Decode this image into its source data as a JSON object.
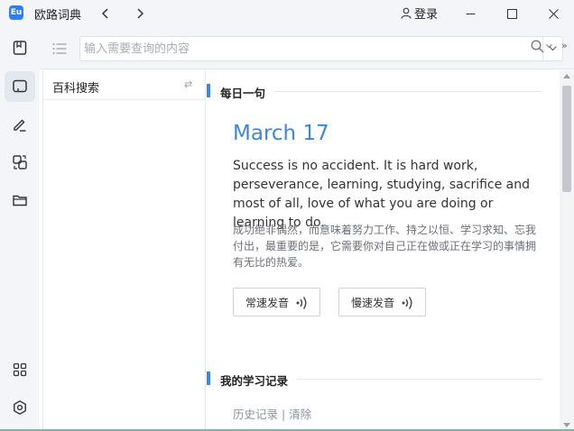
{
  "app": {
    "title": "欧路词典",
    "logo_text": "Eu"
  },
  "titlebar": {
    "login_label": "登录",
    "back_icon": "chevron-left-icon",
    "forward_icon": "chevron-right-icon"
  },
  "rail": {
    "items": [
      {
        "name": "dictionary",
        "icon": "book-icon",
        "active": false
      },
      {
        "name": "encyclopedia",
        "icon": "card-icon",
        "active": true
      },
      {
        "name": "notes",
        "icon": "pencil-icon",
        "active": false
      },
      {
        "name": "translate",
        "icon": "translate-icon",
        "active": false
      },
      {
        "name": "files",
        "icon": "folder-icon",
        "active": false
      },
      {
        "name": "apps",
        "icon": "grid-icon",
        "active": false
      },
      {
        "name": "settings",
        "icon": "gear-icon",
        "active": false
      }
    ]
  },
  "search": {
    "placeholder": "输入需要查询的内容",
    "value": "",
    "more_label": "»"
  },
  "left_panel": {
    "title": "百科搜索",
    "swap_icon": "⇄"
  },
  "daily": {
    "section_title": "每日一句",
    "date": "March 17",
    "quote_en": "Success is no accident. It is hard work, perseverance, learning, studying, sacrifice and most of all, love of what you are doing or learning to do.",
    "quote_zh": "成功绝非偶然，而意味着努力工作、持之以恒、学习求知、忘我付出，最重要的是，它需要你对自己正在做或正在学习的事情拥有无比的热爱。",
    "normal_speed_label": "常速发音",
    "slow_speed_label": "慢速发音"
  },
  "records": {
    "section_title": "我的学习记录",
    "history_label": "历史记录",
    "separator": "|",
    "clear_label": "清除"
  },
  "colors": {
    "accent": "#3c87e6",
    "date_blue": "#3f86d6",
    "chrome_bg": "#f3f5f9",
    "status_line": "#7fb4a4"
  }
}
